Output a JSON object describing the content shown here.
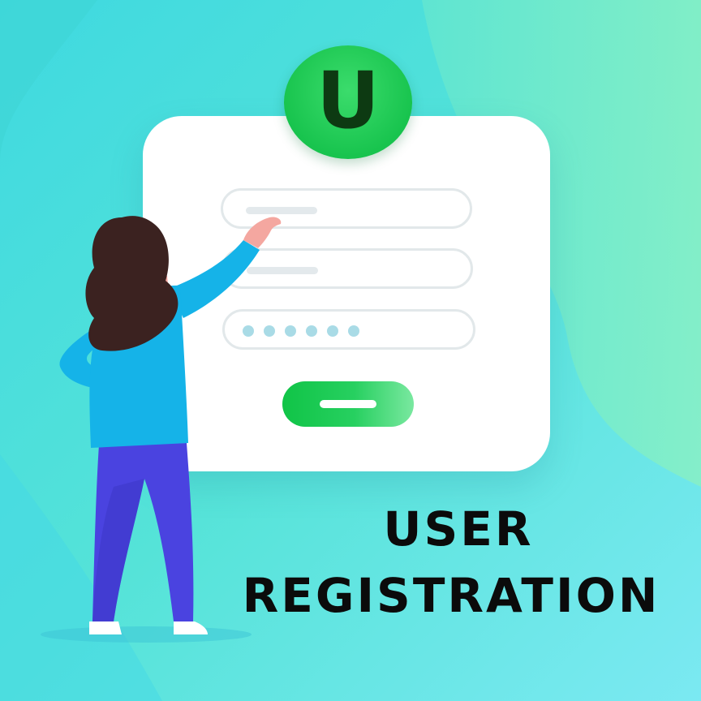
{
  "logo": {
    "letter": "U",
    "icon": "letter-u-logo-icon"
  },
  "headline": {
    "line1": "USER",
    "line2": "REGISTRATION"
  },
  "form": {
    "fields": [
      {
        "kind": "text",
        "icon": "placeholder-line"
      },
      {
        "kind": "text",
        "icon": "placeholder-line"
      },
      {
        "kind": "password",
        "masked_chars": 6
      }
    ],
    "submit": {
      "icon": "submit-line"
    }
  },
  "colors": {
    "accent": "#18c44e",
    "headline": "#0b0b0b",
    "background_top": "#4fe0d8",
    "background_bottom": "#6feaf0",
    "shirt": "#15b3e8",
    "pants": "#4a43e0",
    "hair": "#3b2220"
  }
}
